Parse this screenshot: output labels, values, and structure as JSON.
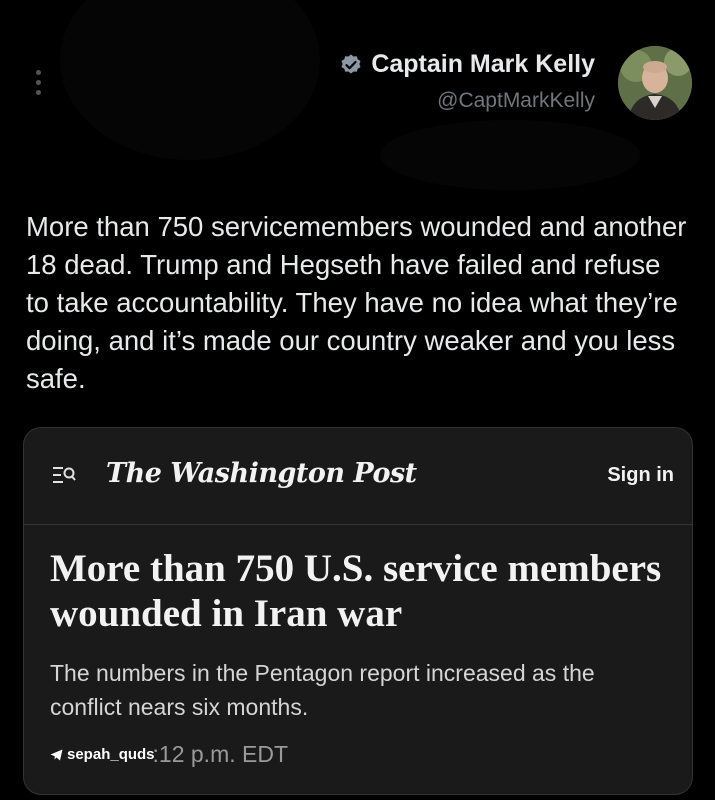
{
  "author": {
    "name": "Captain Mark Kelly",
    "handle": "@CaptMarkKelly"
  },
  "tweet": {
    "text": "More than 750 servicemembers wounded and another 18 dead. Trump and Hegseth have failed and refuse to take accountability. They have no idea what they’re doing, and it’s made our country weaker and you less safe."
  },
  "card": {
    "publication": "The Washington Post",
    "signin_label": "Sign in",
    "headline": "More than 750 U.S. service members wounded in Iran war",
    "dek": "The numbers in the Pentagon report increased as the conflict nears six months.",
    "watermark": "sepah_quds",
    "time": ":12 p.m. EDT"
  },
  "icons": {
    "more": "more-vertical-icon",
    "verified": "verified-badge-icon",
    "menu": "menu-search-icon",
    "telegram": "telegram-icon"
  },
  "colors": {
    "background": "#000000",
    "card": "#1a1a1a",
    "text": "#e7e9ea",
    "muted": "#71767b"
  }
}
